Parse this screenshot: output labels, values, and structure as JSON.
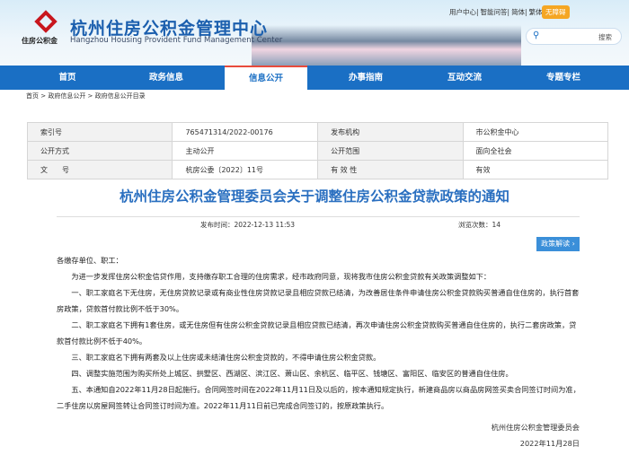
{
  "header": {
    "site_title": "杭州住房公积金管理中心",
    "site_subtitle": "Hangzhou Housing Provident Fund Management Center",
    "logo_text": "住房公积金",
    "top_links": [
      "用户中心|",
      "智能问答|",
      "简体|",
      "繁体|"
    ],
    "accessibility": "无障碍",
    "search_label": "搜索"
  },
  "nav": {
    "items": [
      "首页",
      "政务信息",
      "信息公开",
      "办事指南",
      "互动交流",
      "专题专栏"
    ],
    "active": "信息公开"
  },
  "breadcrumb": "首页 > 政府信息公开 > 政府信息公开目录",
  "meta": [
    [
      "索引号",
      "765471314/2022-00176",
      "发布机构",
      "市公积金中心"
    ],
    [
      "公开方式",
      "主动公开",
      "公开范围",
      "面向全社会"
    ],
    [
      "文　　号",
      "杭房公委〔2022〕11号",
      "有 效 性",
      "有效"
    ]
  ],
  "article": {
    "title": "杭州住房公积金管理委员会关于调整住房公积金贷款政策的通知",
    "publish_time": "发布时间：2022-12-13 11:53",
    "views": "浏览次数：14",
    "interpret_button": "政策解读",
    "salutation": "各缴存单位、职工：",
    "paragraphs": [
      "为进一步发挥住房公积金信贷作用，支持缴存职工合理的住房需求，经市政府同意，现将我市住房公积金贷款有关政策调整如下：",
      "一、职工家庭名下无住房，无住房贷款记录或有商业性住房贷款记录且相应贷款已结清，为改善居住条件申请住房公积金贷款购买普通自住住房的，执行首套房政策，贷款首付款比例不低于30%。",
      "二、职工家庭名下拥有1套住房，或无住房但有住房公积金贷款记录且相应贷款已结清，再次申请住房公积金贷款购买普通自住住房的，执行二套房政策，贷款首付款比例不低于40%。",
      "三、职工家庭名下拥有两套及以上住房或未结清住房公积金贷款的，不得申请住房公积金贷款。",
      "四、调整实施范围为购买所处上城区、拱墅区、西湖区、滨江区、萧山区、余杭区、临平区、钱塘区、富阳区、临安区的普通自住住房。",
      "五、本通知自2022年11月28日起施行。合同网签时间在2022年11月11日及以后的，按本通知规定执行，新建商品房以商品房网签买卖合同签订时间为准，二手住房以房屋网签转让合同签订时间为准。2022年11月11日前已完成合同签订的，按原政策执行。"
    ],
    "signature": "杭州住房公积金管理委员会",
    "date": "2022年11月28日"
  }
}
